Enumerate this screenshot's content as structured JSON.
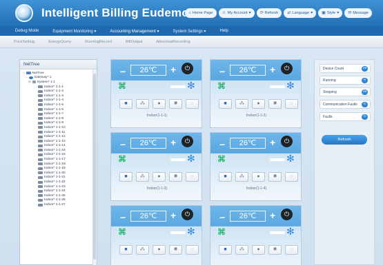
{
  "header": {
    "title": "Intelligent Billing Eudemon",
    "links": [
      {
        "label": "Home Page",
        "icon": "home-icon"
      },
      {
        "label": "My Account",
        "icon": "user-icon"
      },
      {
        "label": "Refresh",
        "icon": "refresh-icon"
      },
      {
        "label": "Language",
        "icon": "language-icon"
      },
      {
        "label": "Style",
        "icon": "style-icon"
      },
      {
        "label": "Message",
        "icon": "message-icon"
      }
    ]
  },
  "mainnav": {
    "items": [
      "Debug Mode",
      "Equipment Monitoring",
      "Accounting Management",
      "System Settings",
      "Help"
    ]
  },
  "subnav": {
    "items": [
      "PriceSetting",
      "EnergyQuery",
      "RunningRecord",
      "BillOutput",
      "AbnormalRecording"
    ]
  },
  "tree": {
    "title": "NetTree",
    "root": "NetTree",
    "gateway": "Gateway* 1",
    "system": "System* 1-1",
    "indoors": [
      "Indoor* 1-1-1",
      "Indoor* 1-1-2",
      "Indoor* 1-1-3",
      "Indoor* 1-1-4",
      "Indoor* 1-1-5",
      "Indoor* 1-1-6",
      "Indoor* 1-1-7",
      "Indoor* 1-1-8",
      "Indoor* 1-1-9",
      "Indoor* 1-1-10",
      "Indoor* 1-1-11",
      "Indoor* 1-1-12",
      "Indoor* 1-1-13",
      "Indoor* 1-1-14",
      "Indoor* 1-1-15",
      "Indoor* 1-1-16",
      "Indoor* 1-1-17",
      "Indoor* 1-1-18",
      "Indoor* 1-1-19",
      "Indoor* 1-1-20",
      "Indoor* 1-1-21",
      "Indoor* 1-1-22",
      "Indoor* 1-1-23",
      "Indoor* 1-1-24",
      "Indoor* 1-1-25",
      "Indoor* 1-1-26",
      "Indoor* 1-1-27"
    ]
  },
  "cards": [
    {
      "temp": "26℃",
      "label": "Indoor(1-1-1)"
    },
    {
      "temp": "26℃",
      "label": "Indoor(1-1-2)"
    },
    {
      "temp": "26℃",
      "label": "Indoor(1-1-3)"
    },
    {
      "temp": "26℃",
      "label": "Indoor(1-1-4)"
    },
    {
      "temp": "26℃",
      "label": ""
    },
    {
      "temp": "26℃",
      "label": ""
    }
  ],
  "card_controls": {
    "minus": "−",
    "plus": "+",
    "power": "⏻"
  },
  "status": {
    "items": [
      {
        "label": "Device Count",
        "count": "29"
      },
      {
        "label": "Running",
        "count": "0"
      },
      {
        "label": "Stopping",
        "count": "29"
      },
      {
        "label": "Communication Faults",
        "count": "0"
      },
      {
        "label": "Faults",
        "count": "0"
      }
    ],
    "refresh_label": "Refresh"
  },
  "colors": {
    "header": "#2b7cc2",
    "accent": "#2d87d6",
    "mode_green": "#2bb673",
    "fan_blue": "#2f8be0"
  }
}
